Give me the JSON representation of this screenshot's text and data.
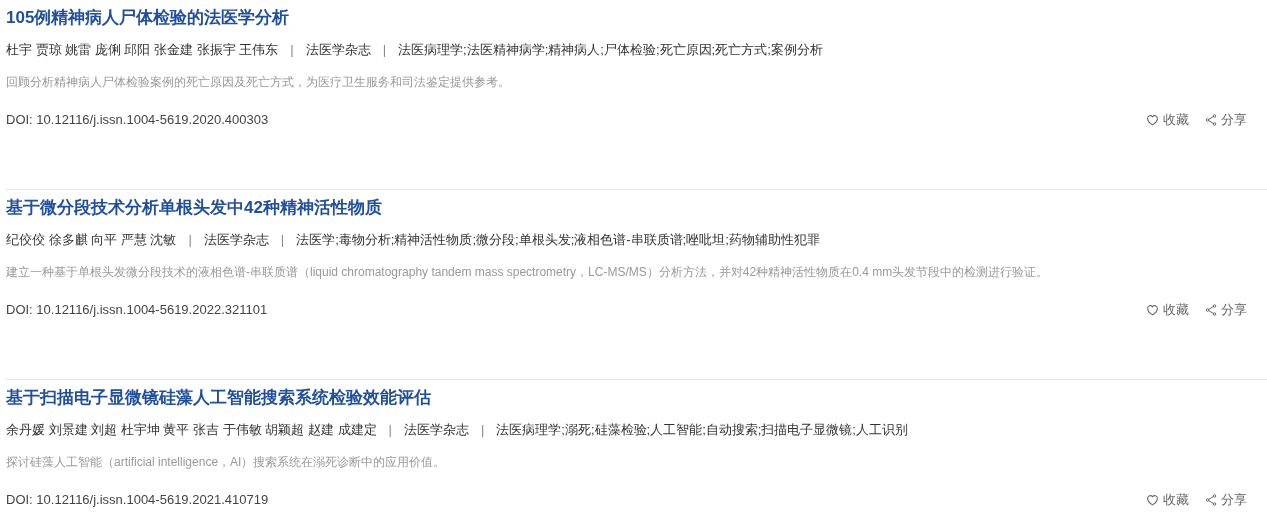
{
  "articles": [
    {
      "title": "105例精神病人尸体检验的法医学分析",
      "authors": "杜宇 贾琼 姚雷 庞俐 邱阳 张金建 张振宇 王伟东",
      "separator_1": "|",
      "journal": "法医学杂志",
      "separator_2": "|",
      "keywords": "法医病理学;法医精神病学;精神病人;尸体检验;死亡原因;死亡方式;案例分析",
      "abstract": "回顾分析精神病人尸体检验案例的死亡原因及死亡方式，为医疗卫生服务和司法鉴定提供参考。",
      "doi": "DOI: 10.12116/j.issn.1004-5619.2020.400303",
      "favorite": "收藏",
      "share": "分享"
    },
    {
      "title": "基于微分段技术分析单根头发中42种精神活性物质",
      "authors": "纪佼佼 徐多麒 向平 严慧 沈敏",
      "separator_1": "|",
      "journal": "法医学杂志",
      "separator_2": "|",
      "keywords": "法医学;毒物分析;精神活性物质;微分段;单根头发;液相色谱-串联质谱;唑吡坦;药物辅助性犯罪",
      "abstract": "建立一种基于单根头发微分段技术的液相色谱-串联质谱（liquid chromatography tandem mass spectrometry，LC-MS/MS）分析方法，并对42种精神活性物质在0.4 mm头发节段中的检测进行验证。",
      "doi": "DOI: 10.12116/j.issn.1004-5619.2022.321101",
      "favorite": "收藏",
      "share": "分享"
    },
    {
      "title": "基于扫描电子显微镜硅藻人工智能搜索系统检验效能评估",
      "authors": "余丹媛 刘景建 刘超 杜宇坤 黄平 张吉 于伟敏 胡颖超 赵建 成建定",
      "separator_1": "|",
      "journal": "法医学杂志",
      "separator_2": "|",
      "keywords": "法医病理学;溺死;硅藻检验;人工智能;自动搜索;扫描电子显微镜;人工识别",
      "abstract": "探讨硅藻人工智能（artificial intelligence，AI）搜索系统在溺死诊断中的应用价值。",
      "doi": "DOI: 10.12116/j.issn.1004-5619.2021.410719",
      "favorite": "收藏",
      "share": "分享"
    }
  ]
}
